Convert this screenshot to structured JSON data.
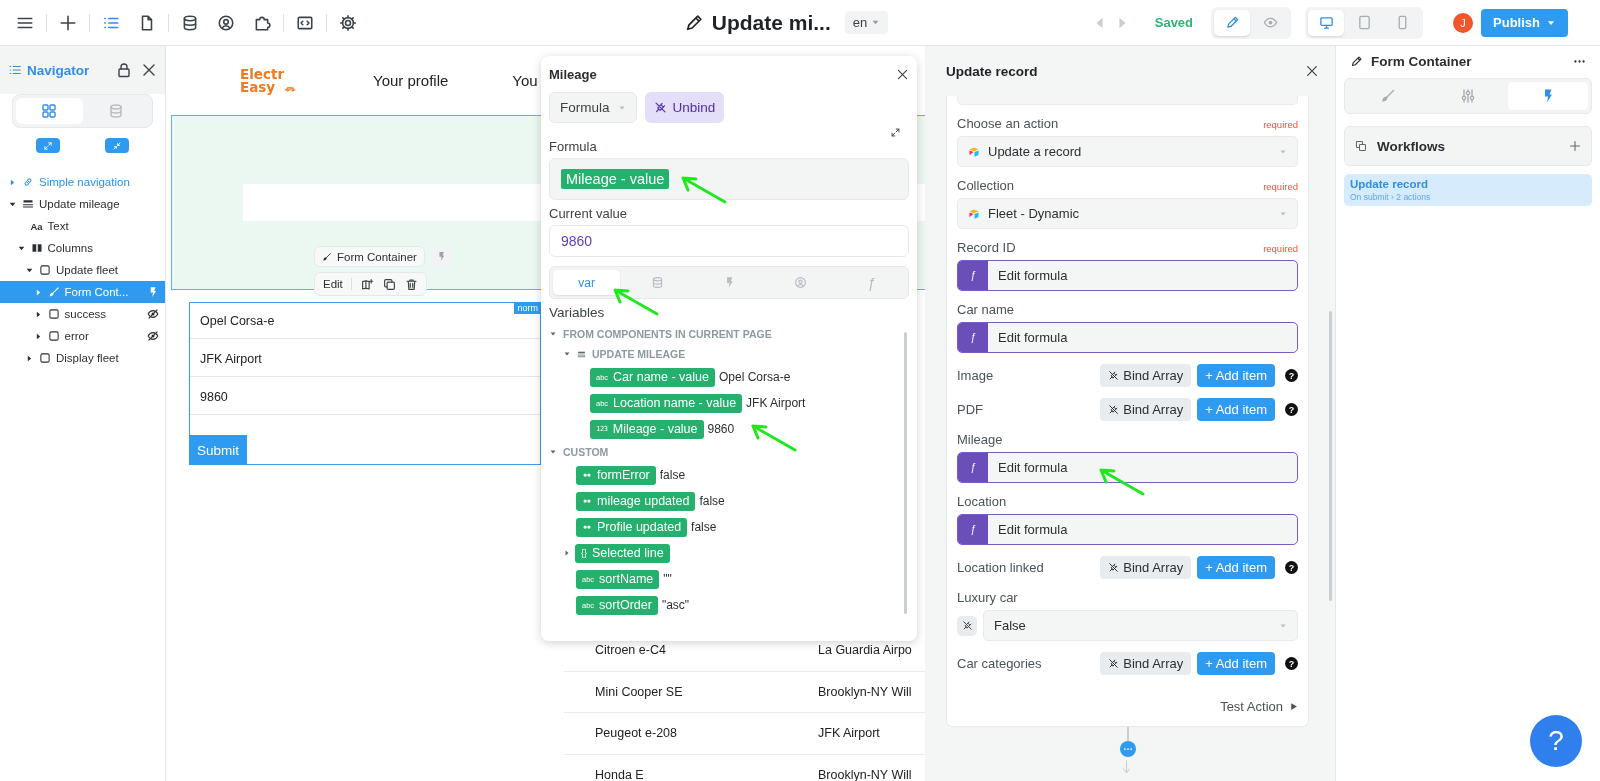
{
  "topbar": {
    "tool_groups": [
      [
        {
          "selected": false
        }
      ],
      [
        {
          "selected": false
        }
      ],
      [
        {
          "selected": true
        },
        {
          "selected": false
        }
      ],
      [
        {
          "selected": false
        },
        {
          "selected": false
        },
        {
          "selected": false
        }
      ],
      [
        {
          "selected": false
        }
      ],
      [
        {
          "selected": false
        }
      ]
    ],
    "title": "Update mi...",
    "language": "en",
    "history": {
      "disabled": true
    },
    "status": "Saved",
    "modes": [
      {
        "kind": "edit",
        "selected": true
      },
      {
        "kind": "preview",
        "selected": false
      }
    ],
    "devices": [
      {
        "kind": "desktop",
        "selected": true
      },
      {
        "kind": "tablet",
        "selected": false
      },
      {
        "kind": "phone",
        "selected": false
      }
    ],
    "avatar": "J",
    "publish": "Publish"
  },
  "navigator": {
    "title": "Navigator",
    "views": [
      {
        "kind": "components",
        "selected": true
      },
      {
        "kind": "data",
        "selected": false
      }
    ],
    "tree": [
      {
        "label": "Simple navigation",
        "kind": "link",
        "expanded": false,
        "selected": false,
        "hidden": false,
        "workflow": false
      },
      {
        "label": "Update mileage",
        "kind": "form",
        "expanded": true,
        "selected": false,
        "hidden": false,
        "workflow": false,
        "children": [
          {
            "label": "Text",
            "kind": "text",
            "glyph": "Aa",
            "selected": false,
            "hidden": false,
            "workflow": false
          },
          {
            "label": "Columns",
            "kind": "columns",
            "expanded": true,
            "selected": false,
            "hidden": false,
            "workflow": false,
            "children": [
              {
                "label": "Update fleet",
                "kind": "container",
                "expanded": true,
                "selected": false,
                "hidden": false,
                "workflow": false,
                "children": [
                  {
                    "label": "Form Cont...",
                    "kind": "form-container",
                    "expanded": false,
                    "selected": true,
                    "hidden": false,
                    "workflow": true
                  },
                  {
                    "label": "success",
                    "kind": "container",
                    "expanded": false,
                    "selected": false,
                    "hidden": true,
                    "workflow": false
                  },
                  {
                    "label": "error",
                    "kind": "container",
                    "expanded": false,
                    "selected": false,
                    "hidden": true,
                    "workflow": false
                  }
                ]
              },
              {
                "label": "Display fleet",
                "kind": "container",
                "expanded": false,
                "selected": false,
                "hidden": false,
                "workflow": false
              }
            ]
          }
        ]
      }
    ]
  },
  "canvas": {
    "logo": {
      "line1": "Electr",
      "line2": "Easy"
    },
    "nav": [
      "Your profile",
      "You"
    ],
    "selection": {
      "component": "Form Container",
      "edit": "Edit"
    },
    "badge": "norm",
    "form": {
      "inputs": [
        "Opel Corsa-e",
        "JFK Airport",
        "9860"
      ],
      "submit": "Submit"
    },
    "table_rows": [
      [
        "Citroen e-C4",
        "La Guardia Airpo"
      ],
      [
        "Mini Cooper SE",
        "Brooklyn-NY Will"
      ],
      [
        "Peugeot e-208",
        "JFK Airport"
      ],
      [
        "Honda E",
        "Brooklyn-NY Will"
      ]
    ]
  },
  "formula_popup": {
    "title": "Mileage",
    "mode": "Formula",
    "unbind": "Unbind",
    "formula_label": "Formula",
    "formula": {
      "token": "Mileage - value",
      "arrow": true
    },
    "current_label": "Current value",
    "current_value": "9860",
    "tabs": [
      {
        "kind": "var",
        "label": "var",
        "selected": true,
        "arrow": true
      },
      {
        "kind": "database",
        "selected": false,
        "arrow": false
      },
      {
        "kind": "workflow",
        "selected": false,
        "arrow": false
      },
      {
        "kind": "user",
        "selected": false,
        "arrow": false
      },
      {
        "kind": "formula",
        "label": "ƒ",
        "selected": false,
        "arrow": false
      }
    ],
    "variables_label": "Variables",
    "groups": [
      {
        "label": "FROM COMPONENTS IN CURRENT PAGE",
        "expanded": true,
        "children": [
          {
            "label": "UPDATE MILEAGE",
            "kind": "form",
            "expanded": true,
            "children": [
              {
                "kind": "text",
                "badge": "abc",
                "name": "Car name - value",
                "value": "Opel Corsa-e",
                "arrow": false
              },
              {
                "kind": "text",
                "badge": "abc",
                "name": "Location name - value",
                "value": "JFK Airport",
                "arrow": false
              },
              {
                "kind": "number",
                "badge": "123",
                "name": "Mileage - value",
                "value": "9860",
                "arrow": true
              }
            ]
          }
        ]
      },
      {
        "label": "CUSTOM",
        "expanded": true,
        "children": [
          {
            "kind": "boolean",
            "name": "formError",
            "value": "false",
            "arrow": false
          },
          {
            "kind": "boolean",
            "name": "mileage updated",
            "value": "false",
            "arrow": false
          },
          {
            "kind": "boolean",
            "name": "Profile updated",
            "value": "false",
            "arrow": false
          },
          {
            "kind": "object",
            "badge": "{}",
            "name": "Selected line",
            "expanded": false,
            "arrow": false
          },
          {
            "kind": "text",
            "badge": "abc",
            "name": "sortName",
            "value": "\"\"",
            "arrow": false
          },
          {
            "kind": "text",
            "badge": "abc",
            "name": "sortOrder",
            "value": "\"asc\"",
            "arrow": false
          }
        ]
      }
    ]
  },
  "workflow": {
    "title": "Update record",
    "fields": [
      {
        "kind": "select",
        "label": "Choose an action",
        "required": "required",
        "value": "Update a record"
      },
      {
        "kind": "select",
        "label": "Collection",
        "required": "required",
        "value": "Fleet - Dynamic"
      },
      {
        "kind": "formula",
        "label": "Record ID",
        "required": "required",
        "glyph": "ƒ",
        "value": "Edit formula",
        "arrow": false
      },
      {
        "kind": "formula",
        "label": "Car name",
        "glyph": "ƒ",
        "value": "Edit formula",
        "arrow": false
      },
      {
        "kind": "array",
        "label": "Image",
        "bind": "Bind Array",
        "add": "+ Add item",
        "help": "?"
      },
      {
        "kind": "array",
        "label": "PDF",
        "bind": "Bind Array",
        "add": "+ Add item",
        "help": "?"
      },
      {
        "kind": "formula",
        "label": "Mileage",
        "glyph": "ƒ",
        "value": "Edit formula",
        "arrow": true
      },
      {
        "kind": "formula",
        "label": "Location",
        "glyph": "ƒ",
        "value": "Edit formula",
        "arrow": false
      },
      {
        "kind": "array",
        "label": "Location linked",
        "bind": "Bind Array",
        "add": "+ Add item",
        "help": "?"
      },
      {
        "kind": "bound-select",
        "label": "Luxury car",
        "value": "False"
      },
      {
        "kind": "array",
        "label": "Car categories",
        "bind": "Bind Array",
        "add": "+ Add item",
        "help": "?"
      }
    ],
    "test": "Test Action"
  },
  "properties": {
    "title": "Form Container",
    "tabs": [
      {
        "kind": "style",
        "selected": false
      },
      {
        "kind": "settings",
        "selected": false
      },
      {
        "kind": "workflows",
        "selected": true
      }
    ],
    "section": "Workflows",
    "workflows": [
      {
        "name": "Update record",
        "detail": "On submit › 2 actions",
        "selected": true
      }
    ]
  },
  "help_button": "?"
}
